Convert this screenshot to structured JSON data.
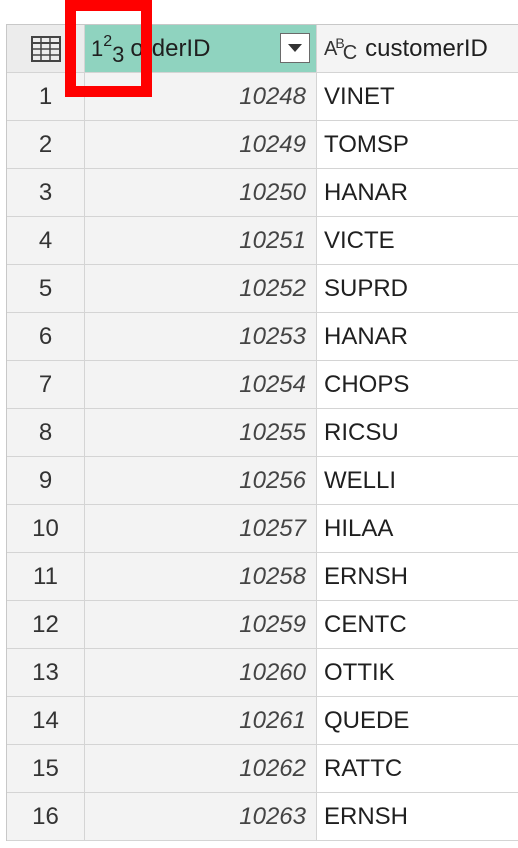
{
  "header": {
    "table_icon": "table-icon",
    "order_type_icon": "whole-number-123-icon",
    "order_label": "orderID",
    "customer_type_icon": "text-abc-icon",
    "customer_label": "customerID"
  },
  "rows": [
    {
      "n": "1",
      "orderID": "10248",
      "customerID": "VINET"
    },
    {
      "n": "2",
      "orderID": "10249",
      "customerID": "TOMSP"
    },
    {
      "n": "3",
      "orderID": "10250",
      "customerID": "HANAR"
    },
    {
      "n": "4",
      "orderID": "10251",
      "customerID": "VICTE"
    },
    {
      "n": "5",
      "orderID": "10252",
      "customerID": "SUPRD"
    },
    {
      "n": "6",
      "orderID": "10253",
      "customerID": "HANAR"
    },
    {
      "n": "7",
      "orderID": "10254",
      "customerID": "CHOPS"
    },
    {
      "n": "8",
      "orderID": "10255",
      "customerID": "RICSU"
    },
    {
      "n": "9",
      "orderID": "10256",
      "customerID": "WELLI"
    },
    {
      "n": "10",
      "orderID": "10257",
      "customerID": "HILAA"
    },
    {
      "n": "11",
      "orderID": "10258",
      "customerID": "ERNSH"
    },
    {
      "n": "12",
      "orderID": "10259",
      "customerID": "CENTC"
    },
    {
      "n": "13",
      "orderID": "10260",
      "customerID": "OTTIK"
    },
    {
      "n": "14",
      "orderID": "10261",
      "customerID": "QUEDE"
    },
    {
      "n": "15",
      "orderID": "10262",
      "customerID": "RATTC"
    },
    {
      "n": "16",
      "orderID": "10263",
      "customerID": "ERNSH"
    }
  ],
  "colors": {
    "selected_header": "#8fd3bf",
    "highlight_box": "#ff0000"
  }
}
